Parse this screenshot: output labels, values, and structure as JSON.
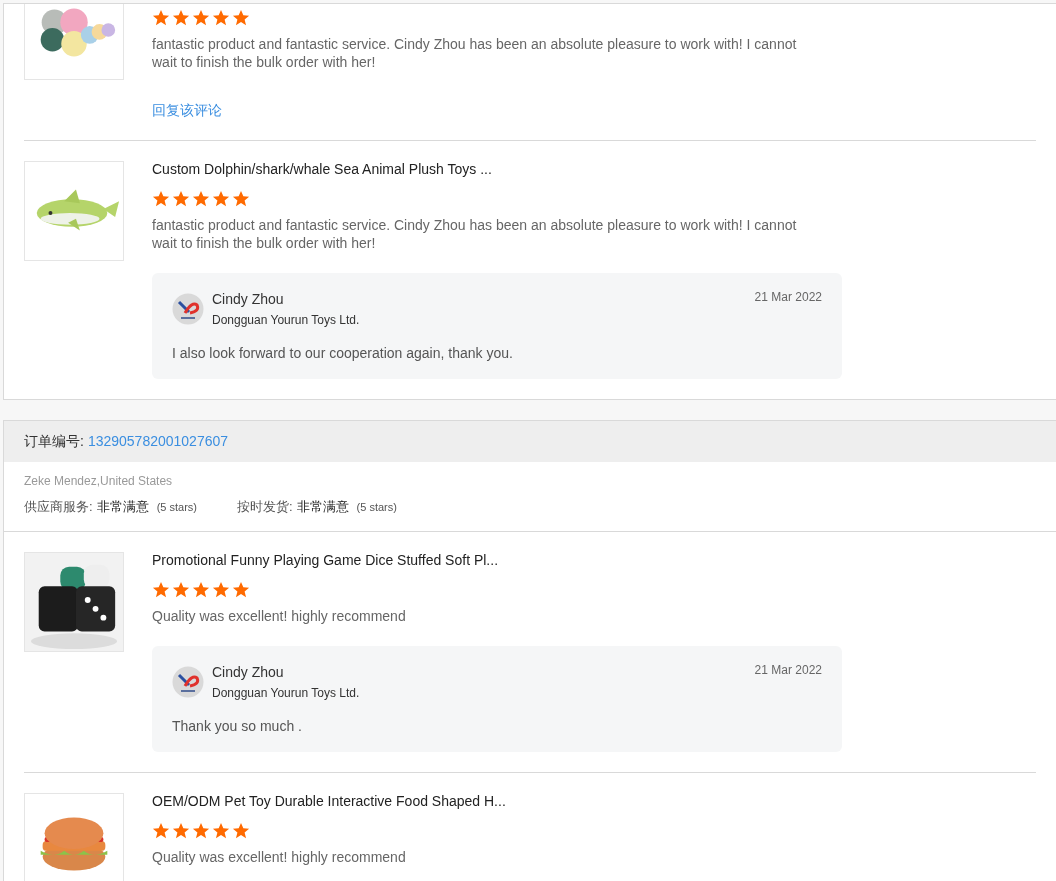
{
  "orders": [
    {
      "items": [
        {
          "stars": 5,
          "review": "fantastic product and fantastic service. Cindy Zhou has been an absolute pleasure to work with! I cannot wait to finish the bulk order with her!",
          "reply_link": "回复该评论"
        },
        {
          "title": "Custom Dolphin/shark/whale Sea Animal Plush Toys ...",
          "stars": 5,
          "review": "fantastic product and fantastic service. Cindy Zhou has been an absolute pleasure to work with! I cannot wait to finish the bulk order with her!",
          "reply": {
            "name": "Cindy Zhou",
            "company": "Dongguan Yourun Toys Ltd.",
            "date": "21 Mar 2022",
            "message": "I also look forward to our cooperation again, thank you."
          }
        }
      ]
    },
    {
      "order_label": "订单编号:",
      "order_number": "132905782001027607",
      "buyer": "Zeke Mendez,United States",
      "ratings": [
        {
          "label": "供应商服务:",
          "value": "非常满意",
          "stars_text": "(5 stars)"
        },
        {
          "label": "按时发货:",
          "value": "非常满意",
          "stars_text": "(5 stars)"
        }
      ],
      "items": [
        {
          "title": "Promotional Funny Playing Game Dice Stuffed Soft Pl...",
          "stars": 5,
          "review": "Quality was excellent! highly recommend",
          "reply": {
            "name": "Cindy Zhou",
            "company": "Dongguan Yourun Toys Ltd.",
            "date": "21 Mar 2022",
            "message": "Thank you so much ."
          }
        },
        {
          "title": "OEM/ODM Pet Toy Durable Interactive Food Shaped H...",
          "stars": 5,
          "review": "Quality was excellent! highly recommend"
        }
      ]
    }
  ]
}
